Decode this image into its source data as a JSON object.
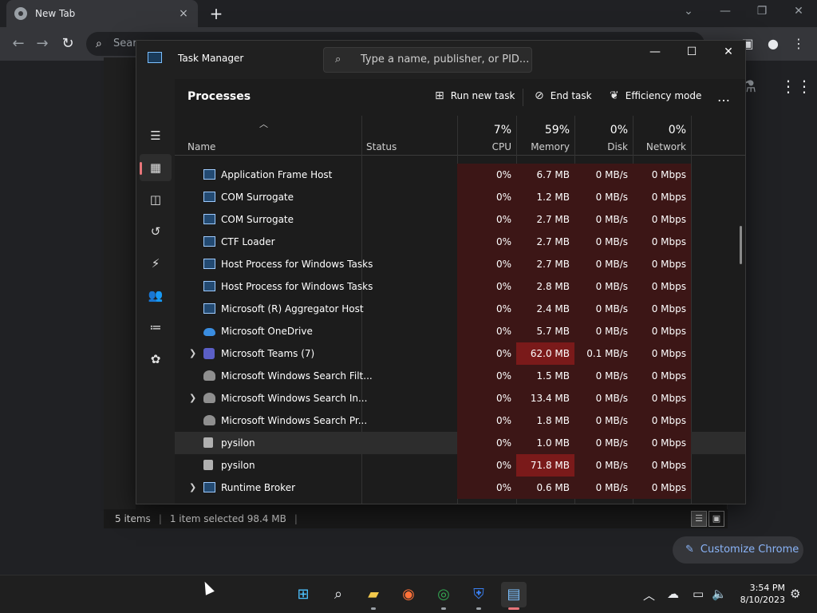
{
  "chrome": {
    "tab_title": "New Tab",
    "tab_close": "×",
    "new_tab": "+",
    "omnibox_placeholder": "Sear",
    "customize_label": "Customize Chrome"
  },
  "explorer": {
    "status_items": "5 items",
    "status_selected": "1 item selected  98.4 MB"
  },
  "taskmanager": {
    "title": "Task Manager",
    "search_placeholder": "Type a name, publisher, or PID...",
    "heading": "Processes",
    "commands": {
      "run_new_task": "Run new task",
      "end_task": "End task",
      "efficiency_mode": "Efficiency mode",
      "more": "…"
    },
    "columns": {
      "name": "Name",
      "status": "Status",
      "cpu_pct": "7%",
      "cpu": "CPU",
      "memory_pct": "59%",
      "memory": "Memory",
      "disk_pct": "0%",
      "disk": "Disk",
      "network_pct": "0%",
      "network": "Network"
    },
    "rows": [
      {
        "name": "Application Frame Host",
        "cpu": "0%",
        "memory": "6.7 MB",
        "disk": "0 MB/s",
        "network": "0 Mbps",
        "icon": "window-icon",
        "expandable": false
      },
      {
        "name": "COM Surrogate",
        "cpu": "0%",
        "memory": "1.2 MB",
        "disk": "0 MB/s",
        "network": "0 Mbps",
        "icon": "window-icon",
        "expandable": false
      },
      {
        "name": "COM Surrogate",
        "cpu": "0%",
        "memory": "2.7 MB",
        "disk": "0 MB/s",
        "network": "0 Mbps",
        "icon": "window-icon",
        "expandable": false
      },
      {
        "name": "CTF Loader",
        "cpu": "0%",
        "memory": "2.7 MB",
        "disk": "0 MB/s",
        "network": "0 Mbps",
        "icon": "window-icon",
        "expandable": false
      },
      {
        "name": "Host Process for Windows Tasks",
        "cpu": "0%",
        "memory": "2.7 MB",
        "disk": "0 MB/s",
        "network": "0 Mbps",
        "icon": "window-icon",
        "expandable": false
      },
      {
        "name": "Host Process for Windows Tasks",
        "cpu": "0%",
        "memory": "2.8 MB",
        "disk": "0 MB/s",
        "network": "0 Mbps",
        "icon": "window-icon",
        "expandable": false
      },
      {
        "name": "Microsoft (R) Aggregator Host",
        "cpu": "0%",
        "memory": "2.4 MB",
        "disk": "0 MB/s",
        "network": "0 Mbps",
        "icon": "window-icon",
        "expandable": false
      },
      {
        "name": "Microsoft OneDrive",
        "cpu": "0%",
        "memory": "5.7 MB",
        "disk": "0 MB/s",
        "network": "0 Mbps",
        "icon": "cloud-icon",
        "expandable": false
      },
      {
        "name": "Microsoft Teams (7)",
        "cpu": "0%",
        "memory": "62.0 MB",
        "disk": "0.1 MB/s",
        "network": "0 Mbps",
        "icon": "teams-icon",
        "expandable": true,
        "mem_hot": true
      },
      {
        "name": "Microsoft Windows Search Filt...",
        "cpu": "0%",
        "memory": "1.5 MB",
        "disk": "0 MB/s",
        "network": "0 Mbps",
        "icon": "search-service-icon",
        "expandable": false
      },
      {
        "name": "Microsoft Windows Search In...",
        "cpu": "0%",
        "memory": "13.4 MB",
        "disk": "0 MB/s",
        "network": "0 Mbps",
        "icon": "search-service-icon",
        "expandable": true
      },
      {
        "name": "Microsoft Windows Search Pr...",
        "cpu": "0%",
        "memory": "1.8 MB",
        "disk": "0 MB/s",
        "network": "0 Mbps",
        "icon": "search-service-icon",
        "expandable": false
      },
      {
        "name": "pysilon",
        "cpu": "0%",
        "memory": "1.0 MB",
        "disk": "0 MB/s",
        "network": "0 Mbps",
        "icon": "app-icon",
        "expandable": false,
        "selected": true
      },
      {
        "name": "pysilon",
        "cpu": "0%",
        "memory": "71.8 MB",
        "disk": "0 MB/s",
        "network": "0 Mbps",
        "icon": "app-icon",
        "expandable": false,
        "mem_hot": true
      },
      {
        "name": "Runtime Broker",
        "cpu": "0%",
        "memory": "0.6 MB",
        "disk": "0 MB/s",
        "network": "0 Mbps",
        "icon": "window-icon",
        "expandable": true
      }
    ]
  },
  "taskbar": {
    "time": "3:54 PM",
    "date": "8/10/2023"
  }
}
